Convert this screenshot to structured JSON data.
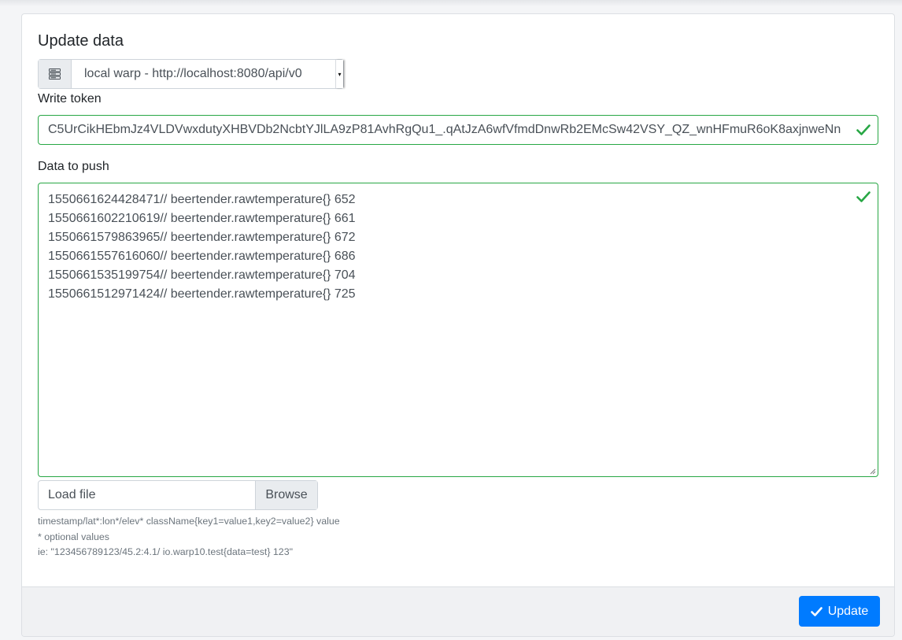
{
  "card": {
    "title": "Update data"
  },
  "endpoint": {
    "icon": "server-icon",
    "selected": "local warp - http://localhost:8080/api/v0"
  },
  "write_token": {
    "label": "Write token",
    "value": "C5UrCikHEbmJz4VLDVwxdutyXHBVDb2NcbtYJlLA9zP81AvhRgQu1_.qAtJzA6wfVfmdDnwRb2EMcSw42VSY_QZ_wnHFmuR6oK8axjnweNn",
    "valid": true
  },
  "data_to_push": {
    "label": "Data to push",
    "lines": [
      "1550661624428471// beertender.rawtemperature{} 652",
      "1550661602210619// beertender.rawtemperature{} 661",
      "1550661579863965// beertender.rawtemperature{} 672",
      "1550661557616060// beertender.rawtemperature{} 686",
      "1550661535199754// beertender.rawtemperature{} 704",
      "1550661512971424// beertender.rawtemperature{} 725"
    ],
    "valid": true
  },
  "file": {
    "placeholder": "Load file",
    "browse_label": "Browse"
  },
  "help": {
    "format": "timestamp/lat*:lon*/elev* className{key1=value1,key2=value2} value",
    "optional": "* optional values",
    "example": "ie: \"123456789123/45.2:4.1/ io.warp10.test{data=test} 123\""
  },
  "footer": {
    "update_label": "Update",
    "update_icon": "check-icon"
  },
  "colors": {
    "valid": "#28a745",
    "primary": "#007bff"
  }
}
